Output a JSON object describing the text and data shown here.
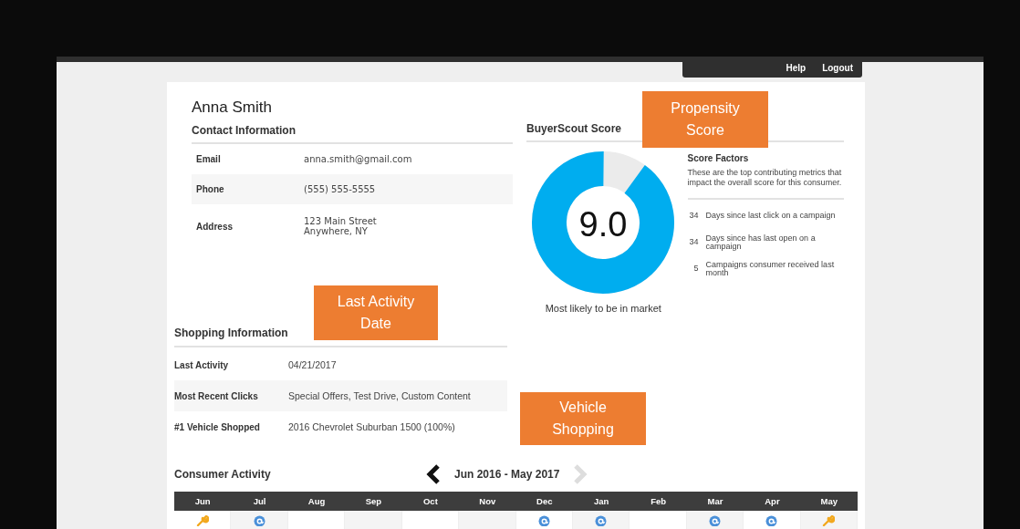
{
  "top_bar": {
    "links": [
      "Help",
      "Logout"
    ]
  },
  "contact": {
    "name": "Anna Smith",
    "title": "Contact Information",
    "rows": [
      {
        "label": "Email",
        "value": "anna.smith@gmail.com"
      },
      {
        "label": "Phone",
        "value": "(555)  555-5555"
      },
      {
        "label": "Address",
        "value": "123 Main Street\nAnywhere,  NY"
      }
    ]
  },
  "score": {
    "title": "BuyerScout Score",
    "value": "9.0",
    "level": 0.9,
    "caption": "Most likely to be in market",
    "factors_title": "Score Factors",
    "factors_text": "These are the top contributing metrics that impact the overall score for this consumer.",
    "factors": [
      {
        "count": "34",
        "text": "Days since last click on a campaign"
      },
      {
        "count": "34",
        "text": "Days since has last open on a campaign"
      },
      {
        "count": "5",
        "text": "Campaigns consumer received last month"
      }
    ]
  },
  "shopping": {
    "title": "Shopping Information",
    "rows": [
      {
        "label": "Last Activity",
        "value": "04/21/2017"
      },
      {
        "label": "Most Recent Clicks",
        "value": "Special Offers, Test Drive, Custom Content"
      },
      {
        "label": "#1 Vehicle Shopped",
        "value": "2016 Chevrolet Suburban 1500 (100%)"
      }
    ]
  },
  "activity": {
    "title": "Consumer Activity",
    "range": "Jun 2016 - May 2017",
    "prev_disabled": false,
    "next_disabled": true,
    "months": [
      {
        "label": "Jun",
        "kind": "wrench"
      },
      {
        "label": "Jul",
        "kind": "email"
      },
      {
        "label": "Aug",
        "kind": "none"
      },
      {
        "label": "Sep",
        "kind": "none"
      },
      {
        "label": "Oct",
        "kind": "none"
      },
      {
        "label": "Nov",
        "kind": "none"
      },
      {
        "label": "Dec",
        "kind": "email"
      },
      {
        "label": "Jan",
        "kind": "email"
      },
      {
        "label": "Feb",
        "kind": "none"
      },
      {
        "label": "Mar",
        "kind": "email"
      },
      {
        "label": "Apr",
        "kind": "email"
      },
      {
        "label": "May",
        "kind": "wrench"
      }
    ]
  },
  "callouts": [
    {
      "text": "Propensity Score"
    },
    {
      "text": "Last Activity Date"
    },
    {
      "text": "Vehicle Shopping"
    }
  ]
}
